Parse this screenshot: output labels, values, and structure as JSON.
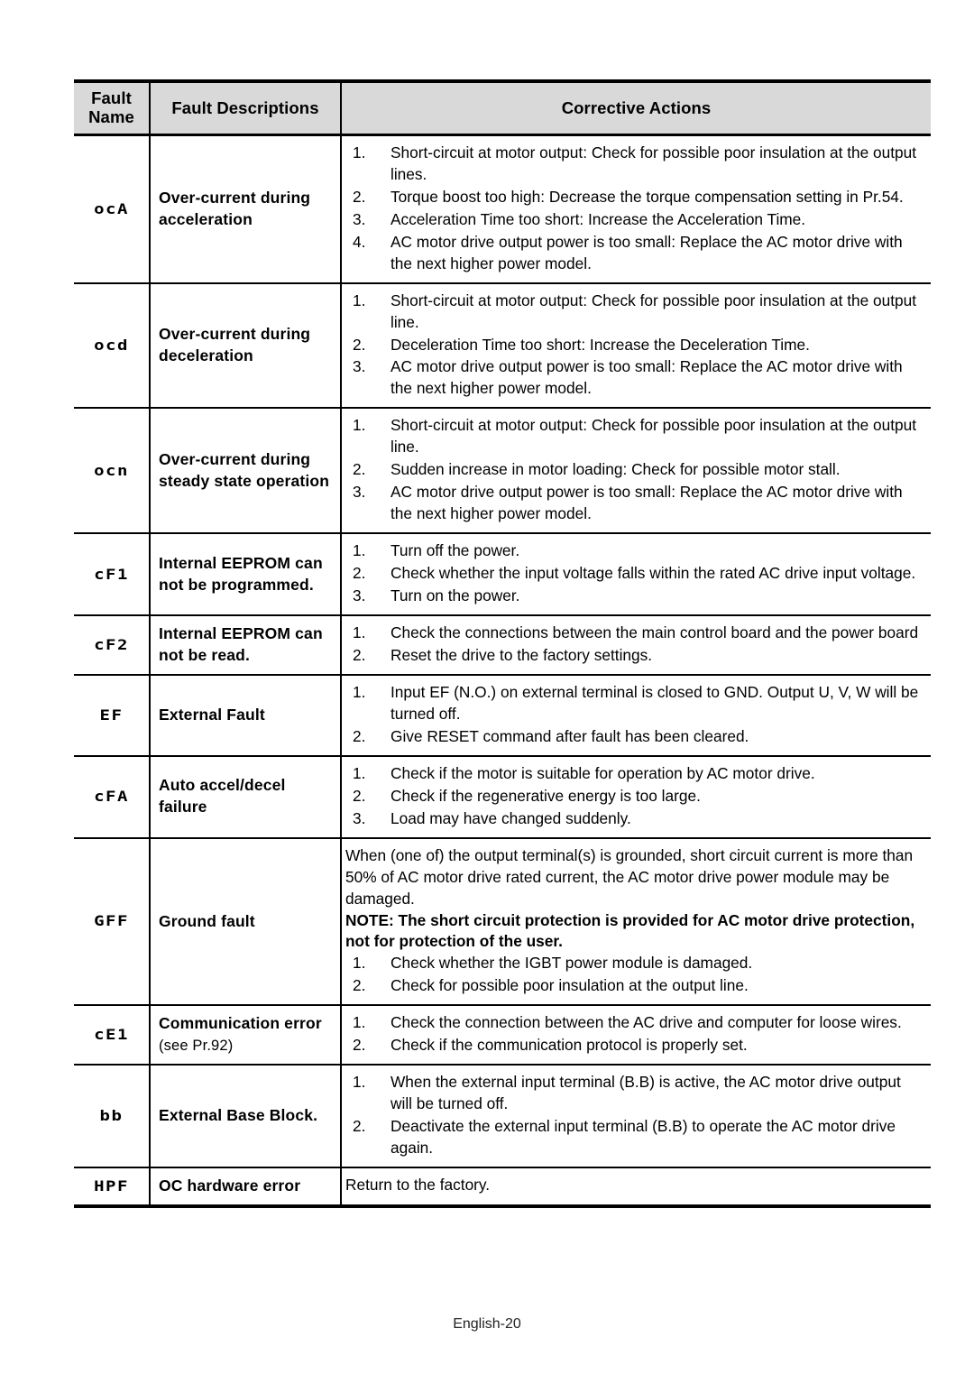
{
  "page": {
    "footer": "English-20"
  },
  "table": {
    "headers": {
      "fault_name": "Fault\nName",
      "fault_name_line1": "Fault",
      "fault_name_line2": "Name",
      "fault_descriptions": "Fault Descriptions",
      "corrective_actions": "Corrective Actions"
    },
    "rows": [
      {
        "code": "ocA",
        "description": "Over-current during acceleration",
        "description_suffix": "",
        "actions": [
          "Short-circuit at motor output: Check for possible poor insulation at the output lines.",
          "Torque boost too high: Decrease the torque compensation setting in Pr.54.",
          "Acceleration Time too short: Increase the Acceleration Time.",
          "AC motor drive output power is too small: Replace the AC motor drive with the next higher power model."
        ],
        "paragraphs": []
      },
      {
        "code": "ocd",
        "description": "Over-current during deceleration",
        "description_suffix": "",
        "actions": [
          "Short-circuit at motor output: Check for possible poor insulation at the output line.",
          "Deceleration Time too short: Increase the Deceleration Time.",
          "AC motor drive output power is too small: Replace the AC motor drive with the next higher power model."
        ],
        "paragraphs": []
      },
      {
        "code": "ocn",
        "description": "Over-current during steady state operation",
        "description_suffix": "",
        "actions": [
          "Short-circuit at motor output: Check for possible poor insulation at the output line.",
          "Sudden increase in motor loading: Check for possible motor stall.",
          "AC motor drive output power is too small: Replace the AC motor drive with the next higher power model."
        ],
        "paragraphs": []
      },
      {
        "code": "cF1",
        "description": "Internal EEPROM can not be programmed.",
        "description_suffix": "",
        "actions": [
          "Turn off the power.",
          "Check whether the input voltage falls within the rated AC drive input voltage.",
          "Turn on the power."
        ],
        "paragraphs": []
      },
      {
        "code": "cF2",
        "description": "Internal EEPROM can not be read.",
        "description_suffix": "",
        "actions": [
          "Check the connections between the main control board and the power board",
          "Reset the drive to the factory settings."
        ],
        "paragraphs": []
      },
      {
        "code": "EF",
        "description": "External Fault",
        "description_suffix": "",
        "actions": [
          "Input EF (N.O.) on external terminal is closed to GND. Output U, V, W will be turned off.",
          "Give RESET command after fault has been cleared."
        ],
        "paragraphs": []
      },
      {
        "code": "cFA",
        "description": "Auto accel/decel failure",
        "description_suffix": "",
        "actions": [
          "Check if the motor is suitable for operation by AC motor drive.",
          "Check if the regenerative energy is too large.",
          "Load may have changed suddenly."
        ],
        "paragraphs": []
      },
      {
        "code": "GFF",
        "description": "Ground fault",
        "description_suffix": "",
        "paragraphs": [
          {
            "text": "When (one of) the output terminal(s) is grounded, short circuit current is more than 50% of AC motor drive rated current, the AC motor drive power module may be damaged.",
            "bold": false
          },
          {
            "text": "NOTE: The short circuit protection is provided for AC motor drive protection, not for protection of the user.",
            "bold": true
          }
        ],
        "actions": [
          "Check whether the IGBT power module is damaged.",
          "Check for possible poor insulation at the output line."
        ]
      },
      {
        "code": "cE1",
        "description": "Communication error ",
        "description_suffix": "(see Pr.92)",
        "actions": [
          "Check the connection between the AC drive and computer for loose wires.",
          "Check if the communication protocol is properly set."
        ],
        "paragraphs": []
      },
      {
        "code": "bb",
        "description": "External Base Block.",
        "description_suffix": "",
        "actions": [
          "When the external input terminal (B.B) is active, the AC motor drive output will be turned off.",
          "Deactivate the external input terminal (B.B) to operate the AC motor drive again."
        ],
        "paragraphs": []
      },
      {
        "code": "HPF",
        "description": "OC hardware error",
        "description_suffix": "",
        "actions": [],
        "paragraphs": [
          {
            "text": "Return to the factory.",
            "bold": false
          }
        ]
      }
    ]
  }
}
